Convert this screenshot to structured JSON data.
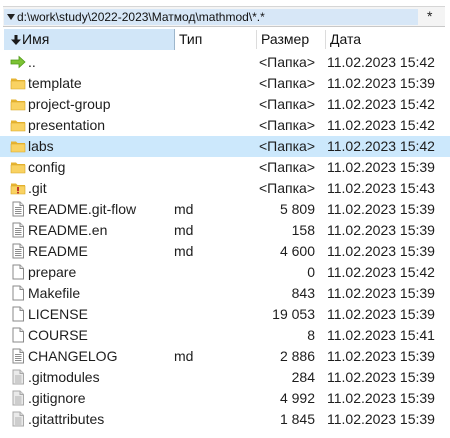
{
  "path": {
    "text": "d:\\work\\study\\2022-2023\\Матмод\\mathmod\\*.*",
    "star": "*"
  },
  "columns": {
    "name": "Имя",
    "ext": "Тип",
    "size": "Размер",
    "date": "Дата"
  },
  "files": [
    {
      "name": "..",
      "ext": "",
      "size": "<Папка>",
      "date": "11.02.2023 15:42",
      "icon": "up-arrow-icon",
      "selected": false
    },
    {
      "name": "template",
      "ext": "",
      "size": "<Папка>",
      "date": "11.02.2023 15:39",
      "icon": "folder-icon",
      "selected": false
    },
    {
      "name": "project-group",
      "ext": "",
      "size": "<Папка>",
      "date": "11.02.2023 15:42",
      "icon": "folder-icon",
      "selected": false
    },
    {
      "name": "presentation",
      "ext": "",
      "size": "<Папка>",
      "date": "11.02.2023 15:42",
      "icon": "folder-icon",
      "selected": false
    },
    {
      "name": "labs",
      "ext": "",
      "size": "<Папка>",
      "date": "11.02.2023 15:42",
      "icon": "folder-icon",
      "selected": true
    },
    {
      "name": "config",
      "ext": "",
      "size": "<Папка>",
      "date": "11.02.2023 15:39",
      "icon": "folder-icon",
      "selected": false
    },
    {
      "name": ".git",
      "ext": "",
      "size": "<Папка>",
      "date": "11.02.2023 15:43",
      "icon": "hidden-folder-icon",
      "selected": false
    },
    {
      "name": "README.git-flow",
      "ext": "md",
      "size": "5 809",
      "date": "11.02.2023 15:39",
      "icon": "text-file-icon",
      "selected": false
    },
    {
      "name": "README.en",
      "ext": "md",
      "size": "158",
      "date": "11.02.2023 15:39",
      "icon": "text-file-icon",
      "selected": false
    },
    {
      "name": "README",
      "ext": "md",
      "size": "4 600",
      "date": "11.02.2023 15:39",
      "icon": "text-file-icon",
      "selected": false
    },
    {
      "name": "prepare",
      "ext": "",
      "size": "0",
      "date": "11.02.2023 15:42",
      "icon": "blank-file-icon",
      "selected": false
    },
    {
      "name": "Makefile",
      "ext": "",
      "size": "843",
      "date": "11.02.2023 15:39",
      "icon": "blank-file-icon",
      "selected": false
    },
    {
      "name": "LICENSE",
      "ext": "",
      "size": "19 053",
      "date": "11.02.2023 15:39",
      "icon": "blank-file-icon",
      "selected": false
    },
    {
      "name": "COURSE",
      "ext": "",
      "size": "8",
      "date": "11.02.2023 15:41",
      "icon": "blank-file-icon",
      "selected": false
    },
    {
      "name": "CHANGELOG",
      "ext": "md",
      "size": "2 886",
      "date": "11.02.2023 15:39",
      "icon": "text-file-icon",
      "selected": false
    },
    {
      "name": ".gitmodules",
      "ext": "",
      "size": "284",
      "date": "11.02.2023 15:39",
      "icon": "hidden-file-icon",
      "selected": false
    },
    {
      "name": ".gitignore",
      "ext": "",
      "size": "4 992",
      "date": "11.02.2023 15:39",
      "icon": "hidden-file-icon",
      "selected": false
    },
    {
      "name": ".gitattributes",
      "ext": "",
      "size": "1 845",
      "date": "11.02.2023 15:39",
      "icon": "hidden-file-icon",
      "selected": false
    }
  ]
}
